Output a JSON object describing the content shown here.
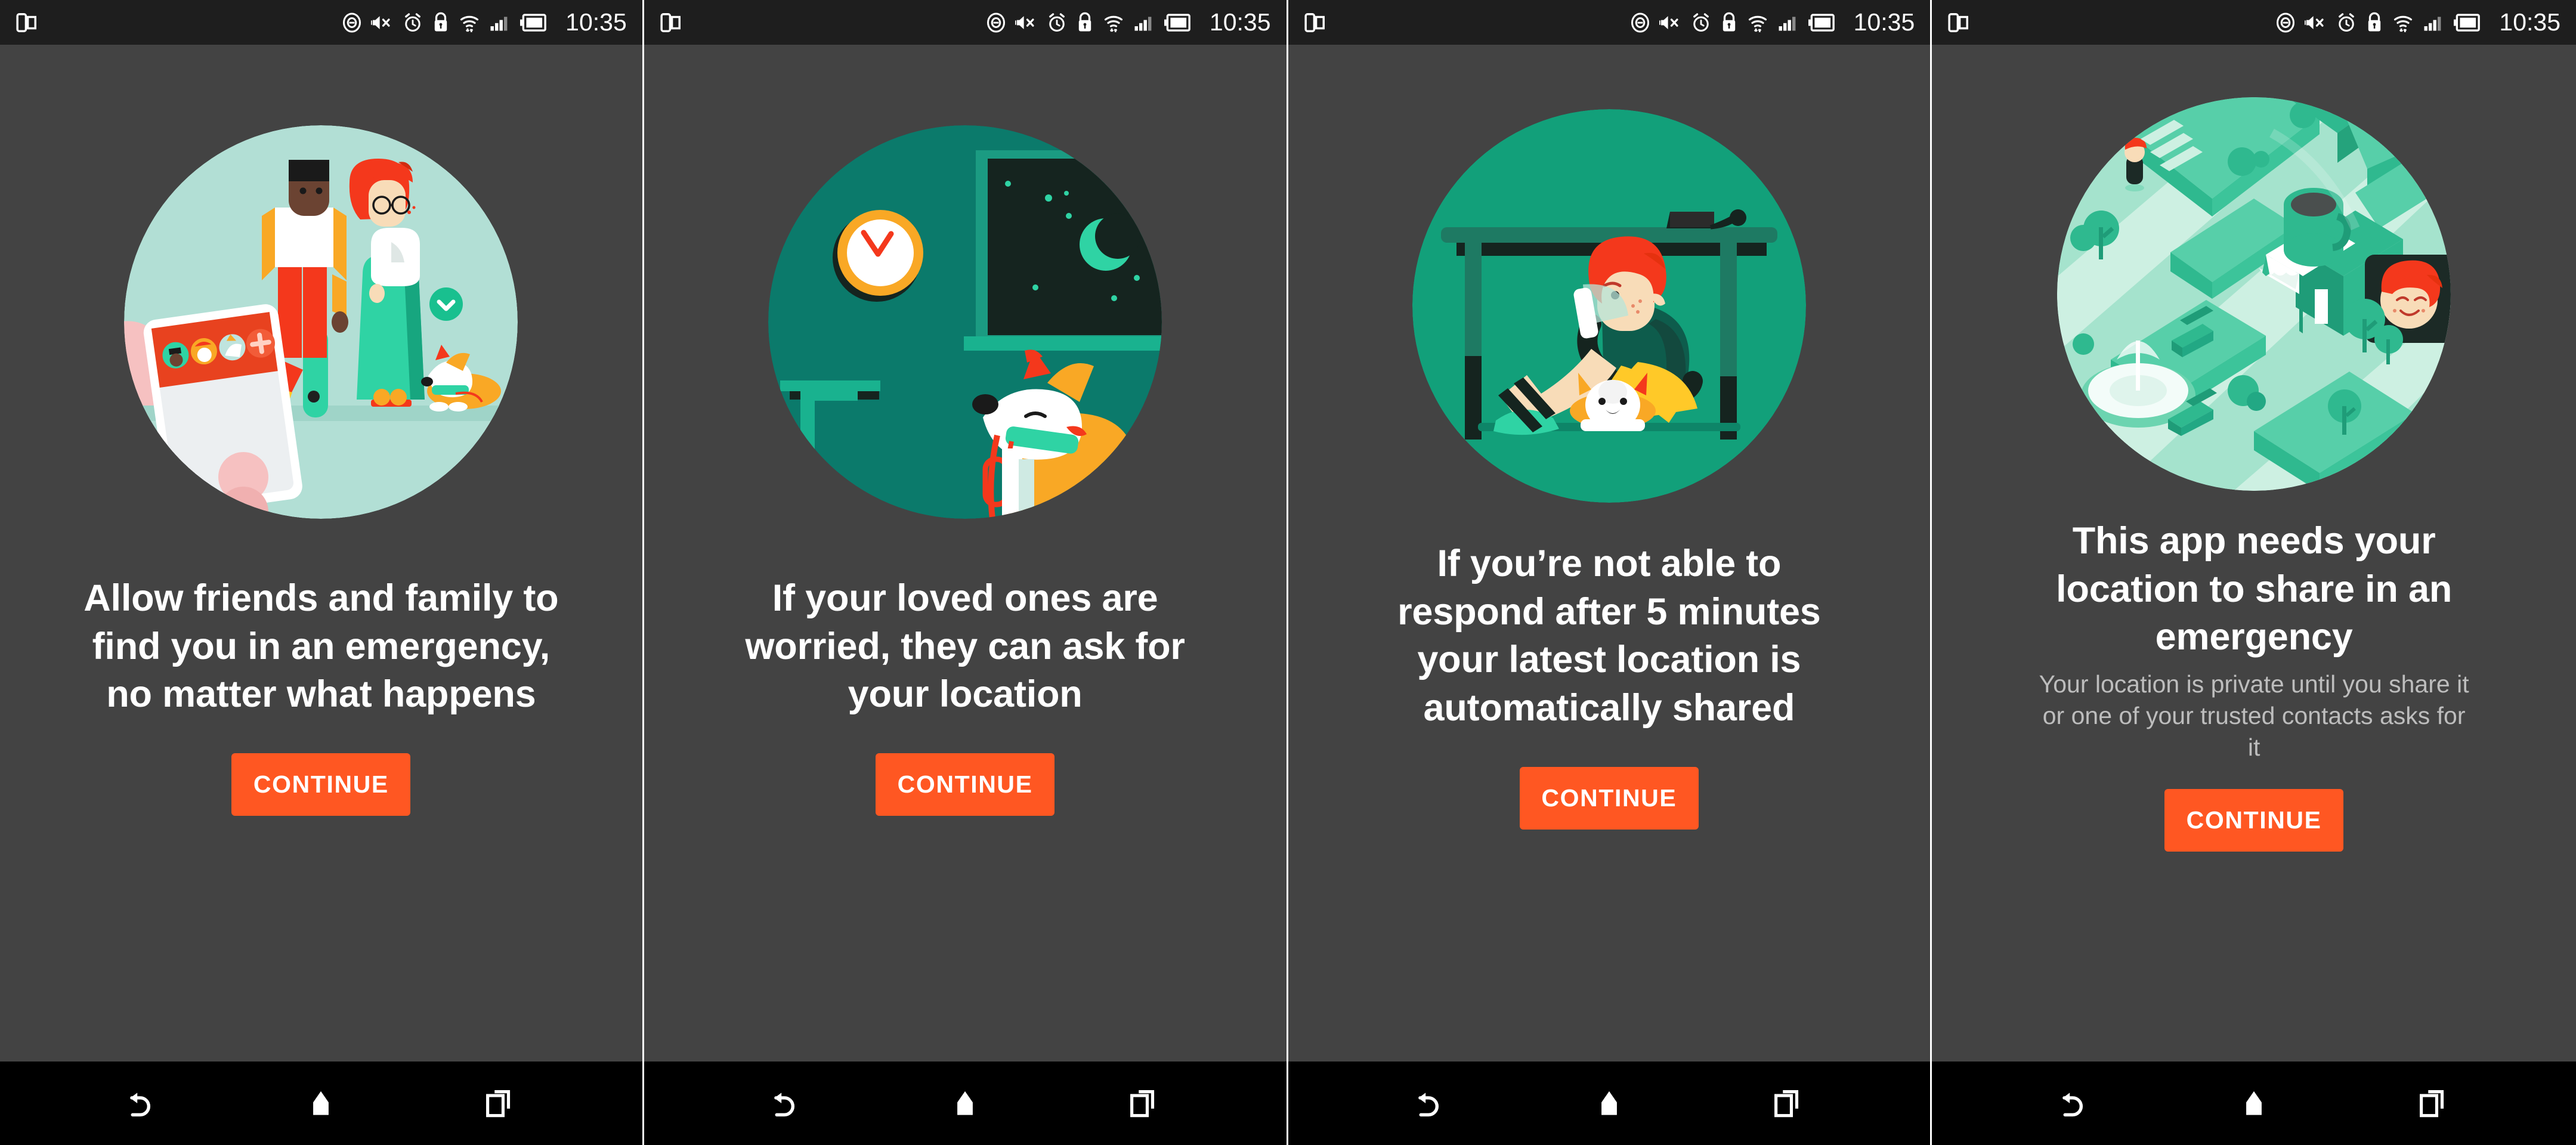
{
  "device": {
    "statusbar": {
      "time": "10:35",
      "left_icons": [
        "split-screen-icon"
      ],
      "right_icons": [
        "do-not-disturb-icon",
        "volume-mute-icon",
        "alarm-icon",
        "screen-lock-rotation-icon",
        "wifi-icon",
        "signal-bars-icon",
        "battery-icon"
      ]
    },
    "navbar": {
      "back_label": "Back",
      "home_label": "Home",
      "recents_label": "Recent apps"
    }
  },
  "colors": {
    "screen_background": "#434343",
    "statusbar_background": "#1e1e1e",
    "navbar_background": "#000000",
    "cta_background": "#ff5722",
    "cta_text": "#ffffff",
    "headline_text": "#ffffff",
    "subtext": "#bdbdbd",
    "divider": "#ffffff",
    "illo_mint": "#b2dfd5",
    "illo_teal_dark": "#0b7a6b",
    "illo_green": "#12a07a",
    "illo_map_light": "#a5e3cd",
    "accent_red": "#f4381c",
    "accent_orange": "#f9a825",
    "accent_yellow": "#ffc928"
  },
  "screens": [
    {
      "index": 1,
      "illustration_name": "friends-family-phone-illustration",
      "headline": "Allow friends and family to\nfind you in an emergency,\nno matter what happens",
      "subtext": "",
      "cta_label": "CONTINUE"
    },
    {
      "index": 2,
      "illustration_name": "night-clock-window-dog-illustration",
      "headline": "If your loved ones are\nworried, they can ask for\nyour location",
      "subtext": "",
      "cta_label": "CONTINUE"
    },
    {
      "index": 3,
      "illustration_name": "person-under-desk-illustration",
      "headline": "If you’re not able to\nrespond after 5 minutes\nyour latest location is\nautomatically shared",
      "subtext": "",
      "cta_label": "CONTINUE"
    },
    {
      "index": 4,
      "illustration_name": "isometric-map-location-illustration",
      "headline": "This app needs your\nlocation to share in an\nemergency",
      "subtext": "Your location is private until you share it\nor one of your trusted contacts asks for\nit",
      "cta_label": "CONTINUE"
    }
  ]
}
